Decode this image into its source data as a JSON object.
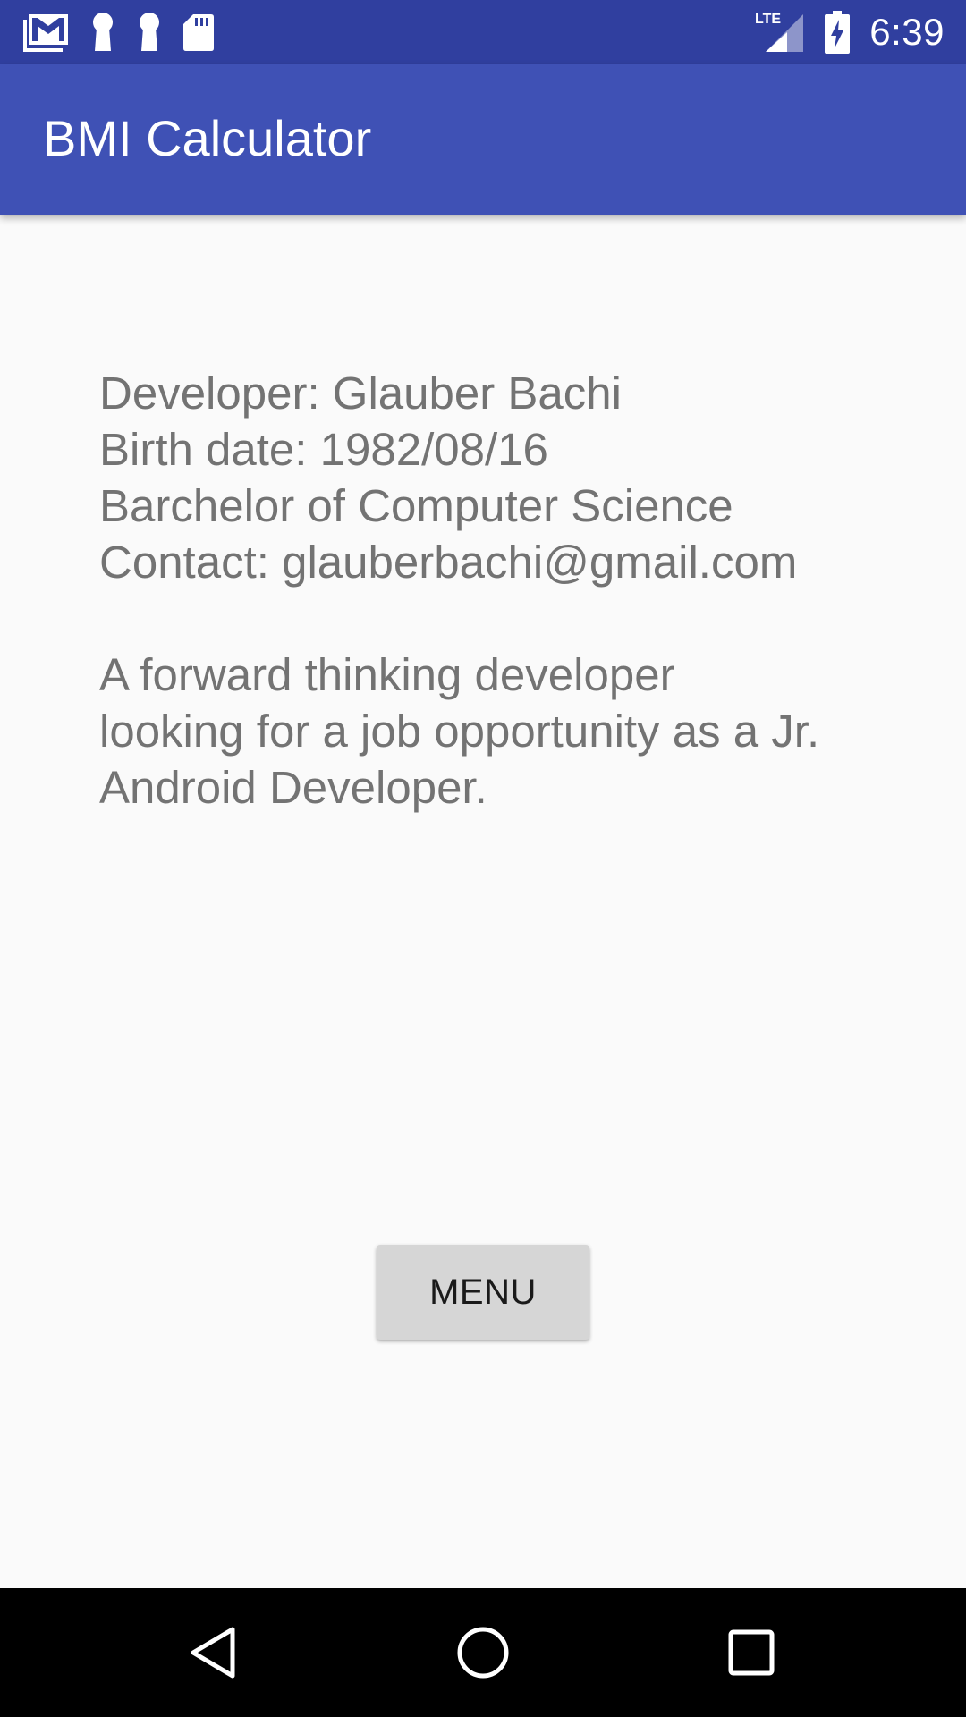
{
  "status_bar": {
    "time": "6:39",
    "network": "LTE",
    "icons": [
      "gmail-icon",
      "key-icon",
      "key-icon",
      "sd-card-icon",
      "lte-signal-icon",
      "battery-charging-icon"
    ]
  },
  "app_bar": {
    "title": "BMI Calculator",
    "color": "#3f51b5"
  },
  "about": {
    "developer": "Developer: Glauber Bachi",
    "birth_date": "Birth date: 1982/08/16",
    "degree": "Barchelor of Computer Science",
    "contact": "Contact: glauberbachi@gmail.com",
    "summary_line1": "A forward thinking developer",
    "summary_line2": "looking for a job opportunity as a Jr.",
    "summary_line3": "Android Developer."
  },
  "menu_button": {
    "label": "MENU"
  },
  "nav_bar": {
    "buttons": [
      "back-icon",
      "home-icon",
      "recents-icon"
    ]
  }
}
